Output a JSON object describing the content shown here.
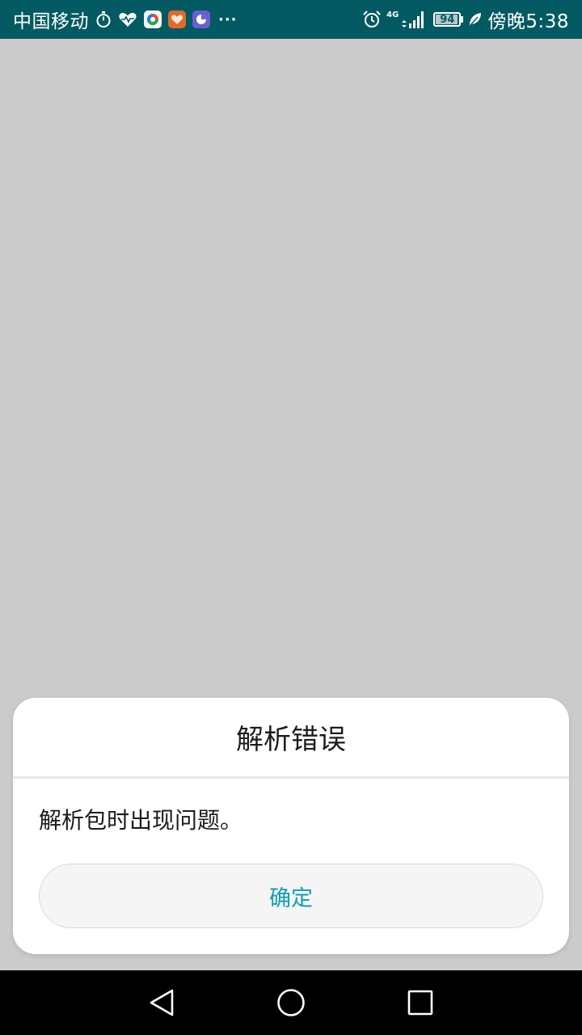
{
  "status_bar": {
    "carrier": "中国移动",
    "more": "···",
    "network": "4G",
    "battery_level": "94",
    "battery_fraction": 0.94,
    "time": "傍晚5:38",
    "background_color": "#035a62"
  },
  "dialog": {
    "title": "解析错误",
    "message": "解析包时出现问题。",
    "confirm_label": "确定",
    "accent_color": "#0f9db4"
  },
  "nav_bar": {
    "back": "back-triangle-icon",
    "home": "home-circle-icon",
    "recents": "recents-square-icon"
  }
}
